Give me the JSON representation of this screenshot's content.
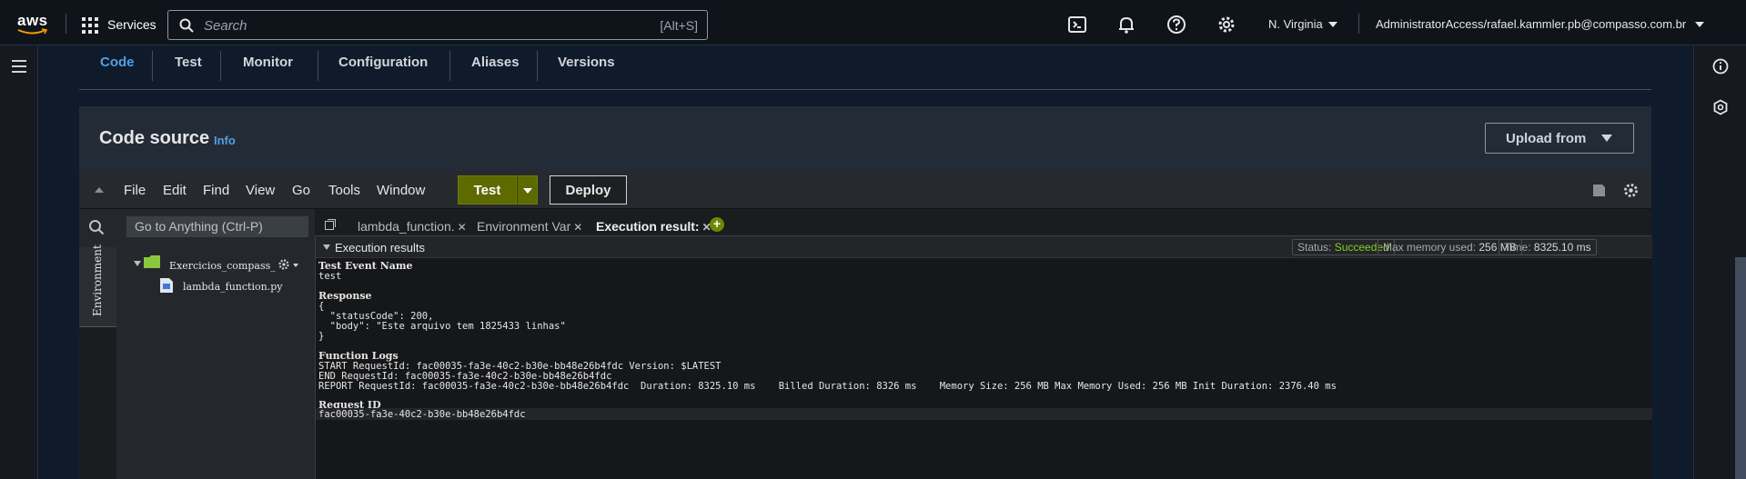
{
  "topnav": {
    "logo": "aws",
    "services_label": "Services",
    "search_placeholder": "Search",
    "search_shortcut": "[Alt+S]",
    "region": "N. Virginia",
    "account": "AdministratorAccess/rafael.kammler.pb@compasso.com.br",
    "icons": [
      "cloudshell-icon",
      "notifications-icon",
      "help-icon",
      "settings-icon"
    ]
  },
  "lambda_tabs": [
    "Code",
    "Test",
    "Monitor",
    "Configuration",
    "Aliases",
    "Versions"
  ],
  "code_source": {
    "title": "Code source",
    "info": "Info",
    "upload_label": "Upload from"
  },
  "ide": {
    "menu": [
      "File",
      "Edit",
      "Find",
      "View",
      "Go",
      "Tools",
      "Window"
    ],
    "test_label": "Test",
    "deploy_label": "Deploy",
    "goto_placeholder": "Go to Anything (Ctrl-P)",
    "env_label": "Environment",
    "tree": {
      "folder": "Exercicios_compass_",
      "file": "lambda_function.py"
    },
    "tabs": [
      "lambda_function.",
      "Environment Var",
      "Execution result:"
    ]
  },
  "execution": {
    "header": "Execution results",
    "status_label": "Status:",
    "status_value": "Succeeded",
    "memory_label": "Max memory used:",
    "memory_value": "256 MB",
    "time_label": "Time:",
    "time_value": "8325.10 ms",
    "test_event_heading": "Test Event Name",
    "test_event_value": "test",
    "response_heading": "Response",
    "response_lines": [
      "{",
      "  \"statusCode\": 200,",
      "  \"body\": \"Este arquivo tem 1825433 linhas\"",
      "}"
    ],
    "logs_heading": "Function Logs",
    "log_lines": [
      "START RequestId: fac00035-fa3e-40c2-b30e-bb48e26b4fdc Version: $LATEST",
      "END RequestId: fac00035-fa3e-40c2-b30e-bb48e26b4fdc",
      "REPORT RequestId: fac00035-fa3e-40c2-b30e-bb48e26b4fdc  Duration: 8325.10 ms    Billed Duration: 8326 ms    Memory Size: 256 MB Max Memory Used: 256 MB Init Duration: 2376.40 ms"
    ],
    "request_heading": "Request ID",
    "request_value": "fac00035-fa3e-40c2-b30e-bb48e26b4fdc"
  }
}
